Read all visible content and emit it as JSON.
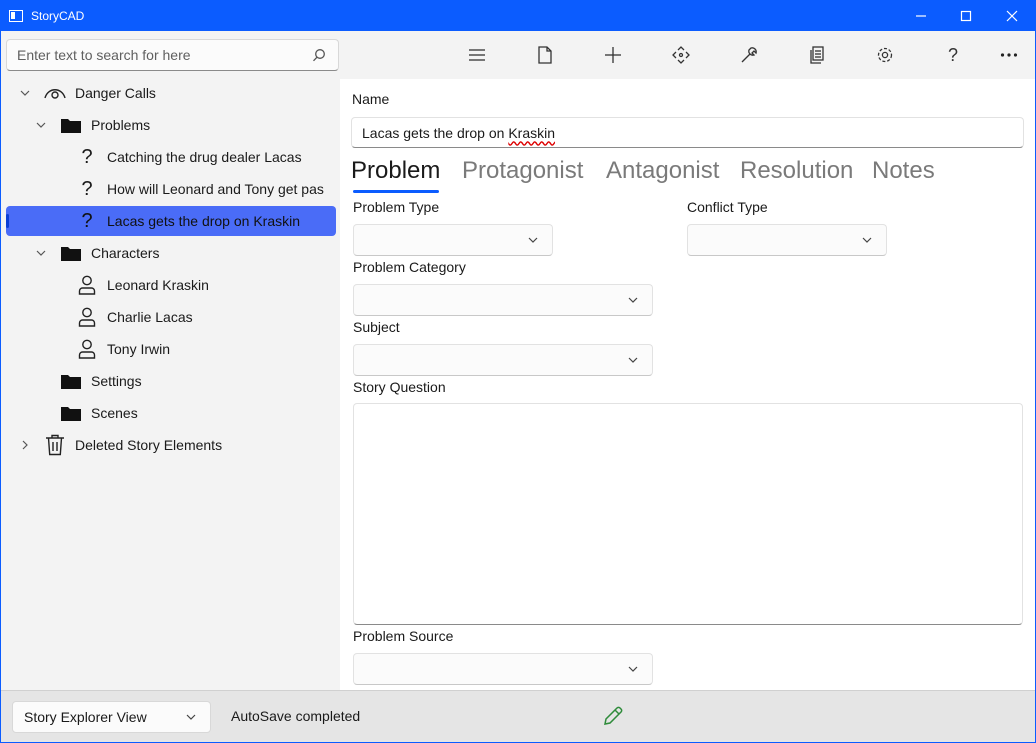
{
  "window": {
    "title": "StoryCAD"
  },
  "search": {
    "placeholder": "Enter text to search for here"
  },
  "tree": {
    "root": "Danger Calls",
    "problems_folder": "Problems",
    "problems": [
      "Catching the drug dealer Lacas",
      "How will Leonard and Tony get pas",
      "Lacas gets the drop on Kraskin"
    ],
    "characters_folder": "Characters",
    "characters": [
      "Leonard Kraskin",
      "Charlie Lacas",
      "Tony Irwin"
    ],
    "settings_folder": "Settings",
    "scenes_folder": "Scenes",
    "deleted": "Deleted Story Elements"
  },
  "toolbar": {
    "icons": [
      "menu-icon",
      "new-file-icon",
      "add-icon",
      "move-icon",
      "tools-icon",
      "copy-icon",
      "settings-icon",
      "help-icon",
      "more-icon"
    ]
  },
  "form": {
    "name_label": "Name",
    "name_value_prefix": "Lacas gets the drop on ",
    "name_value_misspelled": "Kraskin",
    "tabs": [
      "Problem",
      "Protagonist",
      "Antagonist",
      "Resolution",
      "Notes"
    ],
    "active_tab": "Problem",
    "problem_type_label": "Problem Type",
    "conflict_type_label": "Conflict Type",
    "problem_category_label": "Problem Category",
    "subject_label": "Subject",
    "story_question_label": "Story Question",
    "problem_source_label": "Problem Source"
  },
  "statusbar": {
    "view": "Story Explorer View",
    "status": "AutoSave completed"
  },
  "colors": {
    "titlebar": "#0b5cff",
    "selection": "#4a6cf7",
    "tab_underline": "#0b5cff",
    "pencil": "#2e8b3a"
  }
}
